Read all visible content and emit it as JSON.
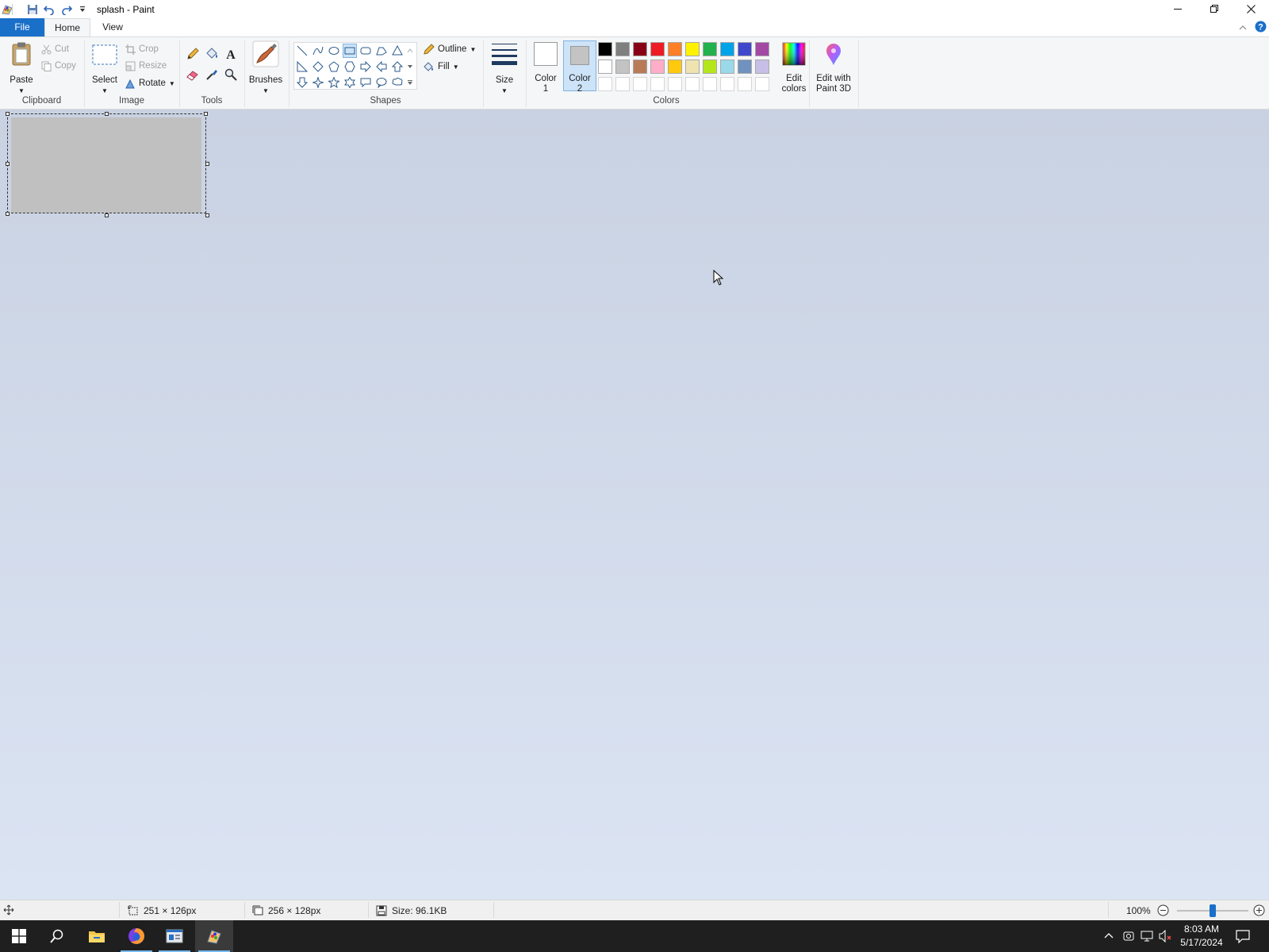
{
  "window": {
    "title": "splash - Paint",
    "controls": {
      "minimize": "minimize-icon",
      "maximize": "restore-icon",
      "close": "close-icon"
    }
  },
  "tabs": [
    {
      "label": "File",
      "active": false
    },
    {
      "label": "Home",
      "active": true
    },
    {
      "label": "View",
      "active": false
    }
  ],
  "ribbon": {
    "clipboard": {
      "group": "Clipboard",
      "paste": "Paste",
      "cut": "Cut",
      "copy": "Copy"
    },
    "image": {
      "group": "Image",
      "select": "Select",
      "crop": "Crop",
      "resize": "Resize",
      "rotate": "Rotate"
    },
    "tools": {
      "group": "Tools"
    },
    "brushes": {
      "label": "Brushes"
    },
    "shapes": {
      "group": "Shapes",
      "outline": "Outline",
      "fill": "Fill"
    },
    "size": {
      "label": "Size"
    },
    "colors": {
      "group": "Colors",
      "color1_line1": "Color",
      "color1_line2": "1",
      "color2_line1": "Color",
      "color2_line2": "2",
      "color1_value": "#ffffff",
      "color2_value": "#c3c3c3",
      "edit_line1": "Edit",
      "edit_line2": "colors",
      "paint3d_line1": "Edit with",
      "paint3d_line2": "Paint 3D",
      "palette_row1": [
        "#000000",
        "#7f7f7f",
        "#880015",
        "#ed1c24",
        "#ff7f27",
        "#fff200",
        "#22b14c",
        "#00a2e8",
        "#3f48cc",
        "#a349a4"
      ],
      "palette_row2": [
        "#ffffff",
        "#c3c3c3",
        "#b97a57",
        "#ffaec9",
        "#ffc90e",
        "#efe4b0",
        "#b5e61d",
        "#99d9ea",
        "#7092be",
        "#c8bfe7"
      ]
    }
  },
  "status": {
    "selection_size": "251 × 126px",
    "image_size": "256 × 128px",
    "file_size": "Size: 96.1KB",
    "zoom": "100%",
    "zoom_level": 0.5
  },
  "taskbar": {
    "time": "8:03 AM",
    "date": "5/17/2024"
  }
}
